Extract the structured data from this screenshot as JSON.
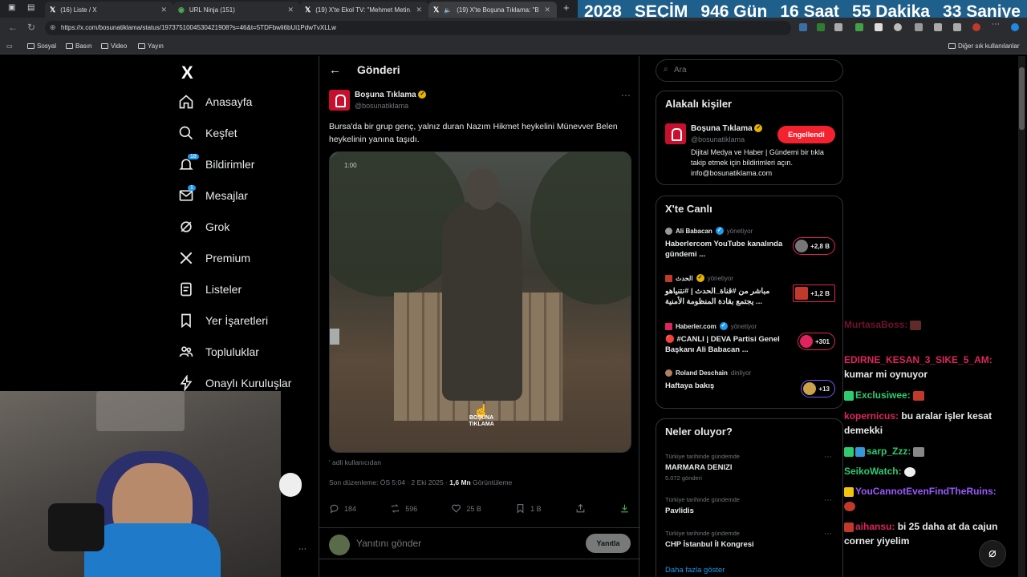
{
  "browser": {
    "tabs": [
      {
        "title": "(16) Liste / X",
        "icon": "x-logo-icon",
        "active": false
      },
      {
        "title": "URL Ninja (151)",
        "icon": "globe-icon",
        "active": false
      },
      {
        "title": "(19) X'te Ekol TV: \"Mehmet Metin...",
        "icon": "x-logo-icon",
        "active": false
      },
      {
        "title": "(19) X'te Boşuna Tıklama: \"B...",
        "icon": "x-logo-icon",
        "active": true
      }
    ],
    "new_tab": "+",
    "url": "https://x.com/bosunatiklama/status/1973751004530421908?s=46&t=5TDFbwli6bUi1PdwTvXLLw",
    "bookmarks": [
      "Sosyal",
      "Basın",
      "Video",
      "Yayın"
    ],
    "other_bookmarks": "Diğer sık kullanılanlar"
  },
  "countdown": {
    "year_label": "2028",
    "event_label": "SEÇİM",
    "days": "946 Gün",
    "hours": "16 Saat",
    "minutes": "55 Dakika",
    "seconds": "33 Saniye"
  },
  "sidebar": {
    "logo": "X",
    "items": [
      {
        "label": "Anasayfa",
        "icon": "home-icon"
      },
      {
        "label": "Keşfet",
        "icon": "search-icon"
      },
      {
        "label": "Bildirimler",
        "icon": "bell-icon",
        "badge": "18"
      },
      {
        "label": "Mesajlar",
        "icon": "mail-icon",
        "badge": "1"
      },
      {
        "label": "Grok",
        "icon": "grok-icon"
      },
      {
        "label": "Premium",
        "icon": "x-premium-icon"
      },
      {
        "label": "Listeler",
        "icon": "list-icon"
      },
      {
        "label": "Yer İşaretleri",
        "icon": "bookmark-icon"
      },
      {
        "label": "Topluluklar",
        "icon": "communities-icon"
      },
      {
        "label": "Onaylı Kuruluşlar",
        "icon": "lightning-icon"
      }
    ]
  },
  "post": {
    "header_title": "Gönderi",
    "author_name": "Boşuna Tıklama",
    "author_handle": "@bosunatiklama",
    "text": "Bursa'da bir grup genç, yalnız duran Nazım Hikmet heykelini Münevver Belen heykelinin yanına taşıdı.",
    "video_time": "1:00",
    "watermark": "BOŞUNA TIKLAMA",
    "edited_by": "' adli kullanıcıdan",
    "edited_label": "Son düzenleme: ÖS 5:04 · 2 Eki 2025 ·",
    "views": "1,6 Mn",
    "views_label": "Görüntüleme",
    "stats": {
      "replies": "184",
      "reposts": "596",
      "likes": "25 B",
      "bookmarks": "1 B"
    },
    "reply_placeholder": "Yanıtını gönder",
    "reply_button": "Yanıtla"
  },
  "right": {
    "search_placeholder": "Ara",
    "related": {
      "title": "Alakalı kişiler",
      "name": "Boşuna Tıklama",
      "handle": "@bosunatiklama",
      "button": "Engellendi",
      "bio": "Dijital Medya ve Haber | Gündemi bir tıkla takip etmek için bildirimleri açın. info@bosunatiklama.com"
    },
    "live": {
      "title": "X'te Canlı",
      "items": [
        {
          "host": "Ali Babacan",
          "role": "yönetiyor",
          "title": "Haberlercom YouTube kanalında gündemi ...",
          "count": "+2,8 B"
        },
        {
          "host": "الحدث",
          "role": "yönetiyor",
          "title": "مباشر من #قناة_الحدث | #نتنياهو يجتمع بقادة المنظومة الأمنية ...",
          "count": "+1,2 B"
        },
        {
          "host": "Haberler.com",
          "role": "yönetiyor",
          "title": "🔴 #CANLI | DEVA Partisi Genel Başkanı Ali Babacan ...",
          "count": "+301"
        },
        {
          "host": "Roland Deschain",
          "role": "dinliyor",
          "title": "Haftaya bakış",
          "count": "+13"
        }
      ]
    },
    "trends": {
      "title": "Neler oluyor?",
      "items": [
        {
          "context": "Türkiye tarihinde gündemde",
          "title": "MARMARA DENIZI",
          "count": "5.072 gönderi"
        },
        {
          "context": "Türkiye tarihinde gündemde",
          "title": "Pavlidis",
          "count": ""
        },
        {
          "context": "Türkiye tarihinde gündemde",
          "title": "CHP İstanbul İl Kongresi",
          "count": ""
        }
      ],
      "more": "Daha fazla göster"
    }
  },
  "chat": [
    {
      "user": "MurtasaBoss:",
      "msg": "",
      "color": "#e0245e"
    },
    {
      "user": "EDIRNE_KESAN_3_SIKE_5_AM:",
      "msg": "kumar mi oynuyor",
      "color": "#e0245e"
    },
    {
      "user": "Exclusiwee:",
      "msg": "",
      "color": "#2ecc71"
    },
    {
      "user": "kopernicus:",
      "msg": "bu aralar işler kesat demekki",
      "color": "#e0245e"
    },
    {
      "user": "sarp_Zzz:",
      "msg": "",
      "color": "#2ecc71"
    },
    {
      "user": "SeikoWatch:",
      "msg": "",
      "color": "#2ecc71"
    },
    {
      "user": "YouCannotEvenFindTheRuins:",
      "msg": "",
      "color": "#9b59ff"
    },
    {
      "user": "aihansu:",
      "msg": "bi 25 daha at da cajun corner yiyelim",
      "color": "#e0245e"
    }
  ],
  "colors": {
    "accent": "#1d9bf0",
    "live": "#e0245e",
    "verified": "#e6b400",
    "countdown_bg": "#1f5f8c"
  }
}
